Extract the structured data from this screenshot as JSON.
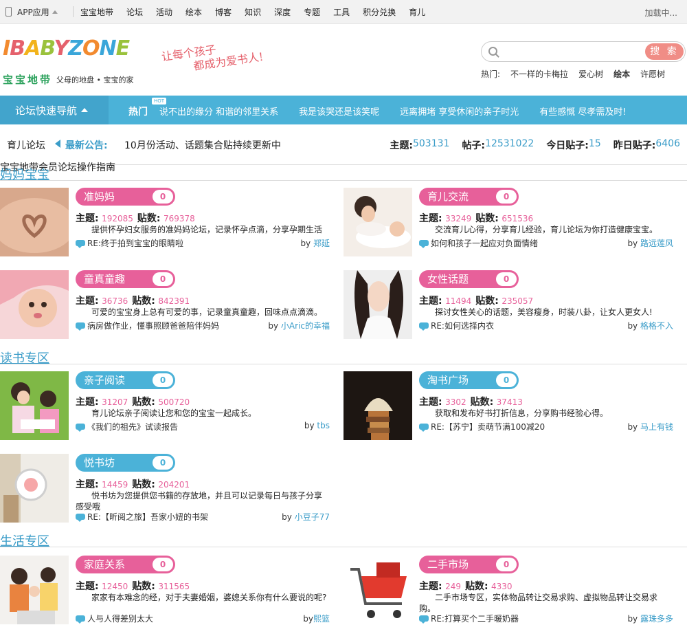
{
  "topbar": {
    "app_label": "APP应用",
    "nav": [
      "宝宝地带",
      "论坛",
      "活动",
      "绘本",
      "博客",
      "知识",
      "深度",
      "专题",
      "工具",
      "积分兑换",
      "育儿"
    ],
    "loading": "加载中..."
  },
  "header": {
    "logo_text": "IBABYZONE",
    "logo_cn": "宝宝地带",
    "logo_tag": "父母的地盘 • 宝宝的家",
    "slogan_line1": "让每个孩子",
    "slogan_line2": "都成为爱书人!",
    "search_placeholder": "",
    "search_button": "搜 索",
    "hot_label": "热门:",
    "hot_items": [
      "不一样的卡梅拉",
      "爱心树",
      "绘本",
      "许愿树"
    ]
  },
  "bluenav": {
    "quick": "论坛快速导航",
    "hot": "热门",
    "hot_tag": "HOT",
    "links": [
      "说不出的缘分 和谐的邻里关系",
      "我是该哭还是该笑呢",
      "远离拥堵 享受休闲的亲子时光",
      "有些感慨 尽孝需及时!"
    ]
  },
  "forumbar": {
    "title": "育儿论坛",
    "notice_label": "最新公告:",
    "notice_text": "10月份活动、话题集合贴持续更新中",
    "topics_label": "主题:",
    "topics": "503131",
    "posts_label": "帖子:",
    "posts": "12531022",
    "today_label": "今日贴子:",
    "today": "15",
    "yesterday_label": "昨日贴子:",
    "yesterday": "6406"
  },
  "guide": "宝宝地带会员论坛操作指南",
  "labels": {
    "topics": "主题:",
    "posts": "贴数:",
    "by": "by"
  },
  "sections": [
    {
      "title": "妈妈宝宝",
      "forums": [
        {
          "name": "准妈妈",
          "count": "0",
          "topics": "192085",
          "posts": "769378",
          "desc": "提供怀孕妇女服务的准妈妈论坛，记录怀孕点滴，分享孕期生活",
          "latest": "RE:终于拍到宝宝的眼睛啦",
          "user": "郑延",
          "color": "pink"
        },
        {
          "name": "育儿交流",
          "count": "0",
          "topics": "33249",
          "posts": "651536",
          "desc": "交流育儿心得，分享育儿经验，育儿论坛为你打造健康宝宝。",
          "latest": "如何和孩子一起应对负面情绪",
          "user": "路远莲风",
          "color": "pink"
        },
        {
          "name": "童真童趣",
          "count": "0",
          "topics": "36736",
          "posts": "842391",
          "desc": "可爱的宝宝身上总有可爱的事，记录童真童趣，回味点点滴滴。",
          "latest": "病房做作业，懂事照顾爸爸陪伴妈妈",
          "user": "小Aric的幸福",
          "color": "pink"
        },
        {
          "name": "女性话题",
          "count": "0",
          "topics": "11494",
          "posts": "235057",
          "desc": "探讨女性关心的话题，美容瘦身，时装八卦，让女人更女人!",
          "latest": "RE:如何选择内衣",
          "user": "格格不入",
          "color": "pink"
        }
      ]
    },
    {
      "title": "读书专区",
      "forums": [
        {
          "name": "亲子阅读",
          "count": "0",
          "topics": "31207",
          "posts": "500720",
          "desc": "育儿论坛亲子阅读让您和您的宝宝一起成长。",
          "latest": "《我们的祖先》试读报告",
          "user": "tbs",
          "color": "blue"
        },
        {
          "name": "淘书广场",
          "count": "0",
          "topics": "3302",
          "posts": "37413",
          "desc": "获取和发布好书打折信息，分享购书经验心得。",
          "latest": "RE:【苏宁】卖萌节满100减20",
          "user": "马上有钱",
          "color": "blue"
        },
        {
          "name": "悦书坊",
          "count": "0",
          "topics": "14459",
          "posts": "204201",
          "desc": "悦书坊为您提供您书籍的存放地，并且可以记录每日与孩子分享感受哦",
          "latest": "RE:【昕阅之旅】吾家小妞的书架",
          "user": "小豆子77",
          "color": "blue"
        }
      ]
    },
    {
      "title": "生活专区",
      "forums": [
        {
          "name": "家庭关系",
          "count": "0",
          "topics": "12450",
          "posts": "311565",
          "desc": "家家有本难念的经，对于夫妻婚姻，婆媳关系你有什么要说的呢?",
          "latest": "人与人得差别太大",
          "user": "熙篮",
          "color": "pink"
        },
        {
          "name": "二手市场",
          "count": "0",
          "topics": "249",
          "posts": "4330",
          "desc": "二手市场专区，实体物品转让交易求购、虚拟物品转让交易求购。",
          "latest": "RE:打算买个二手暖奶器",
          "user": "露珠多多",
          "color": "pink"
        }
      ]
    }
  ]
}
